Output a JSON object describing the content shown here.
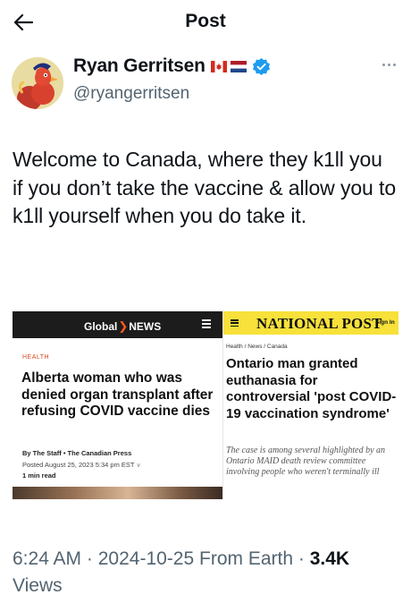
{
  "header": {
    "title": "Post"
  },
  "author": {
    "display_name": "Ryan Gerritsen",
    "flags": [
      "Canada flag",
      "Netherlands flag"
    ],
    "handle": "@ryangerritsen",
    "verified": true
  },
  "tweet": {
    "text": "Welcome to Canada, where they k1ll you if you don’t take the vaccine & allow you to k1ll yourself when you do take it."
  },
  "media": {
    "left": {
      "logo_text": "Global",
      "logo_text_2": "NEWS",
      "kicker": "HEALTH",
      "headline": "Alberta woman who was denied organ transplant after refusing COVID vaccine dies",
      "byline": "By The Staff • The Canadian Press",
      "date": "Posted August 25, 2023 5:34 pm EST",
      "read_time": "1 min read"
    },
    "right": {
      "logo_text": "NATIONAL POST",
      "sign_in": "Sign In",
      "breadcrumbs": "Health / News / Canada",
      "headline": "Ontario man granted euthanasia for controversial 'post COVID-19 vaccination syndrome'",
      "deck": "The case is among several highlighted by an Ontario MAID death review committee involving people who weren't terminally ill"
    }
  },
  "meta": {
    "time": "6:24 AM",
    "date": "2024-10-25",
    "source": "From Earth",
    "views_count": "3.4K",
    "views_label": "Views"
  },
  "colors": {
    "text": "#0f1419",
    "secondary": "#536471",
    "verified": "#1d9bf0",
    "global_news_bar": "#1c1c1c",
    "national_post_bar": "#f7e13a"
  }
}
